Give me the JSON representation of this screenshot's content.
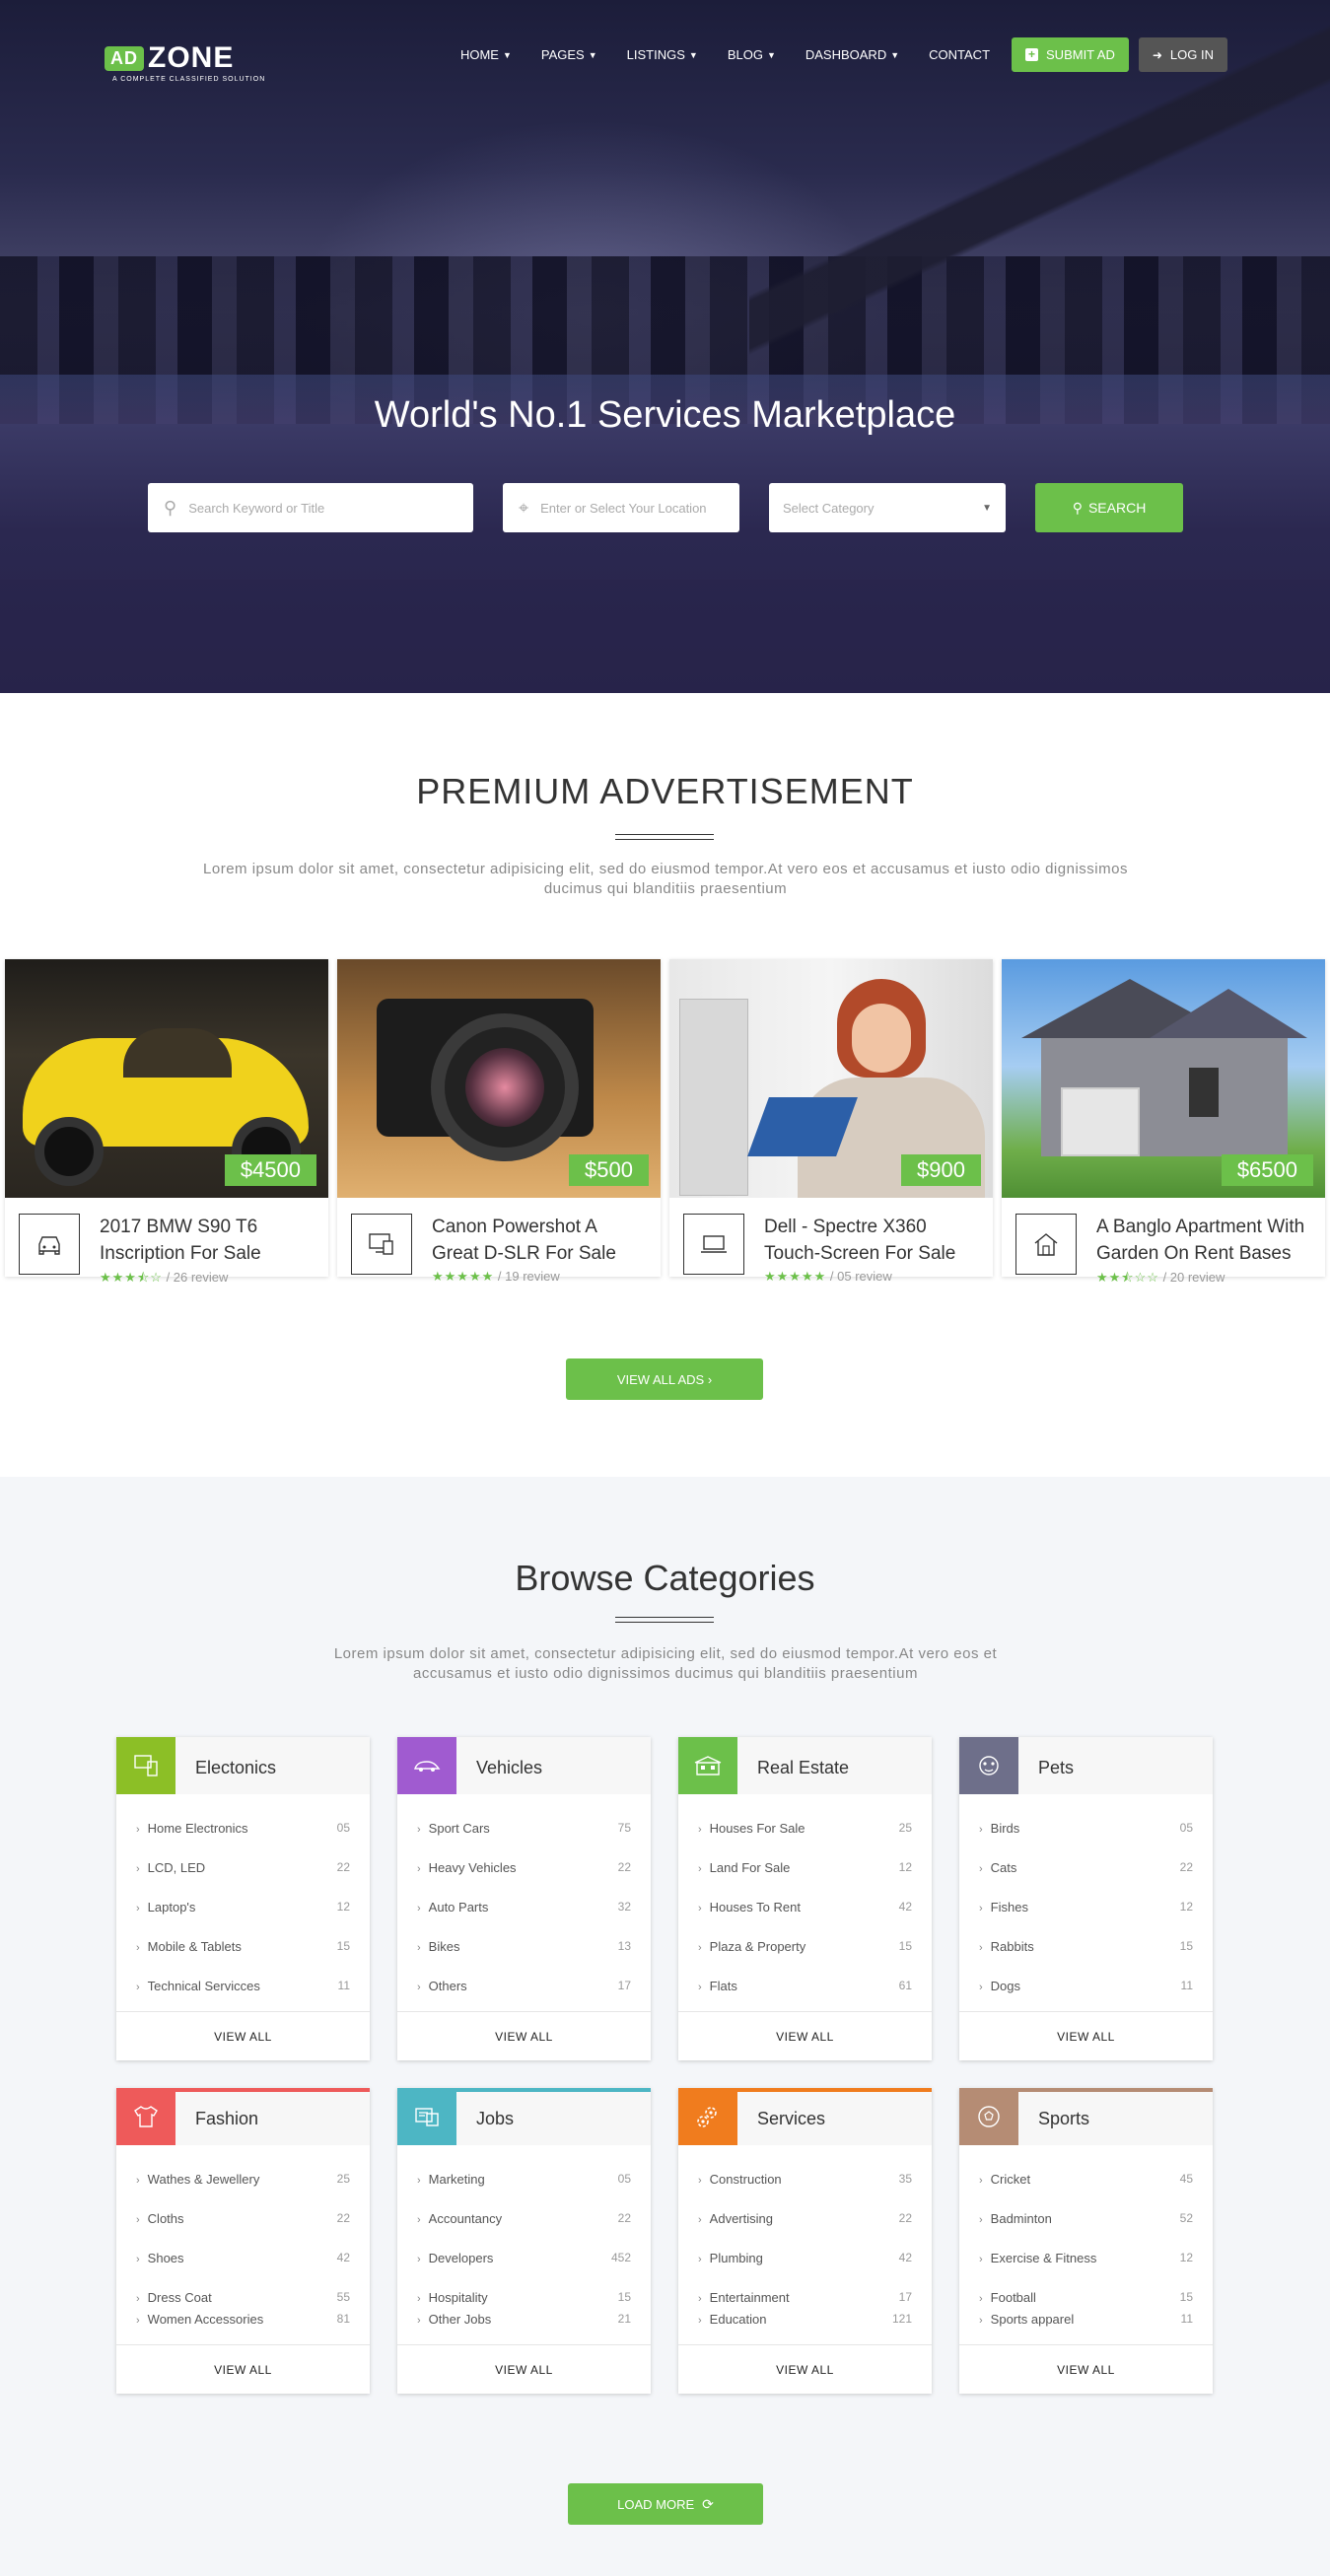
{
  "header": {
    "logo_ad": "AD",
    "logo_zone": "ZONE",
    "logo_tagline": "A COMPLETE CLASSIFIED SOLUTION",
    "nav": [
      "HOME",
      "PAGES",
      "LISTINGS",
      "BLOG",
      "DASHBOARD",
      "CONTACT"
    ],
    "submit_label": "SUBMIT AD",
    "login_label": "LOG IN"
  },
  "hero": {
    "title": "World's No.1 Services Marketplace",
    "search_placeholder": "Search Keyword or Title",
    "location_placeholder": "Enter or Select Your Location",
    "category_placeholder": "Select Category",
    "search_button": "SEARCH"
  },
  "premium": {
    "title": "PREMIUM ADVERTISEMENT",
    "lead": "Lorem ipsum dolor sit amet, consectetur adipisicing elit, sed do eiusmod tempor.At vero eos et accusamus et iusto odio dignissimos ducimus qui blanditiis praesentium",
    "ads": [
      {
        "title": "2017 BMW S90 T6 Inscription For Sale",
        "price": "$4500",
        "stars": "★★★⯪☆",
        "reviews": "/ 26 review",
        "icon": "car-icon"
      },
      {
        "title": "Canon Powershot A Great D-SLR For Sale",
        "price": "$500",
        "stars": "★★★★★",
        "reviews": "/ 19 review",
        "icon": "devices-icon"
      },
      {
        "title": "Dell - Spectre X360 Touch-Screen For Sale",
        "price": "$900",
        "stars": "★★★★★",
        "reviews": "/ 05 review",
        "icon": "laptop-icon"
      },
      {
        "title": "A Banglo Apartment With Garden On Rent Bases",
        "price": "$6500",
        "stars": "★★⯪☆☆",
        "reviews": "/ 20 review",
        "icon": "house-icon"
      }
    ],
    "view_all": "VIEW ALL ADS ›"
  },
  "categories": {
    "title": "Browse Categories",
    "lead": "Lorem ipsum dolor sit amet, consectetur adipisicing elit, sed do eiusmod tempor.At vero eos et accusamus et iusto odio dignissimos ducimus qui blanditiis praesentium",
    "view_all": "VIEW ALL",
    "load_more": "LOAD MORE",
    "row1": [
      {
        "name": "Electonics",
        "color": "#8cbf26",
        "icon": "monitor-icon",
        "items": [
          [
            "Home Electronics",
            "05"
          ],
          [
            "LCD, LED",
            "22"
          ],
          [
            "Laptop's",
            "12"
          ],
          [
            "Mobile & Tablets",
            "15"
          ],
          [
            "Technical Servicces",
            "11"
          ]
        ]
      },
      {
        "name": "Vehicles",
        "color": "#a05bd0",
        "icon": "car-icon",
        "items": [
          [
            "Sport Cars",
            "75"
          ],
          [
            "Heavy Vehicles",
            "22"
          ],
          [
            "Auto Parts",
            "32"
          ],
          [
            "Bikes",
            "13"
          ],
          [
            "Others",
            "17"
          ]
        ]
      },
      {
        "name": "Real Estate",
        "color": "#6cc04a",
        "icon": "building-icon",
        "items": [
          [
            "Houses For Sale",
            "25"
          ],
          [
            "Land For Sale",
            "12"
          ],
          [
            "Houses To Rent",
            "42"
          ],
          [
            "Plaza & Property",
            "15"
          ],
          [
            "Flats",
            "61"
          ]
        ]
      },
      {
        "name": "Pets",
        "color": "#6e6f8a",
        "icon": "paw-icon",
        "items": [
          [
            "Birds",
            "05"
          ],
          [
            "Cats",
            "22"
          ],
          [
            "Fishes",
            "12"
          ],
          [
            "Rabbits",
            "15"
          ],
          [
            "Dogs",
            "11"
          ]
        ]
      }
    ],
    "row2": [
      {
        "name": "Fashion",
        "color": "#ee5a5a",
        "icon": "shirt-icon",
        "items": [
          [
            "Wathes & Jewellery",
            "25"
          ],
          [
            "Cloths",
            "22"
          ],
          [
            "Shoes",
            "42"
          ],
          [
            "Dress Coat",
            "55"
          ],
          [
            "Women Accessories",
            "81"
          ]
        ]
      },
      {
        "name": "Jobs",
        "color": "#4db6c4",
        "icon": "briefcase-icon",
        "items": [
          [
            "Marketing",
            "05"
          ],
          [
            "Accountancy",
            "22"
          ],
          [
            "Developers",
            "452"
          ],
          [
            "Hospitality",
            "15"
          ],
          [
            "Other Jobs",
            "21"
          ]
        ]
      },
      {
        "name": "Services",
        "color": "#f07c1e",
        "icon": "gears-icon",
        "items": [
          [
            "Construction",
            "35"
          ],
          [
            "Advertising",
            "22"
          ],
          [
            "Plumbing",
            "42"
          ],
          [
            "Entertainment",
            "17"
          ],
          [
            "Education",
            "121"
          ]
        ]
      },
      {
        "name": "Sports",
        "color": "#b58c74",
        "icon": "ball-icon",
        "items": [
          [
            "Cricket",
            "45"
          ],
          [
            "Badminton",
            "52"
          ],
          [
            "Exercise & Fitness",
            "12"
          ],
          [
            "Football",
            "15"
          ],
          [
            "Sports apparel",
            "11"
          ]
        ]
      }
    ]
  },
  "colors": {
    "accent": "#6cc04a"
  }
}
